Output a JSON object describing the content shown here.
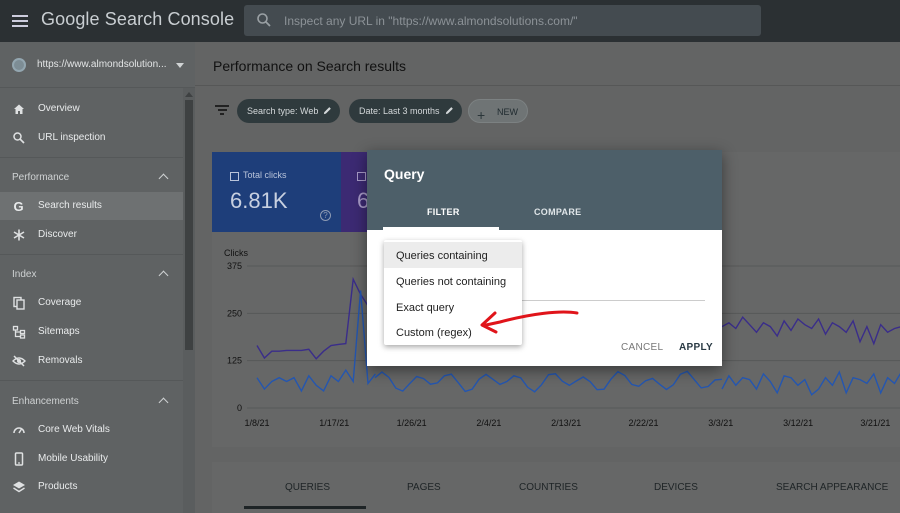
{
  "app": {
    "logo_text": "Google Search Console",
    "search_placeholder": "Inspect any URL in \"https://www.almondsolutions.com/\""
  },
  "sidebar": {
    "property": "https://www.almondsolution...",
    "items_top": [
      {
        "label": "Overview",
        "icon": "home-icon"
      },
      {
        "label": "URL inspection",
        "icon": "search-icon"
      }
    ],
    "sections": [
      {
        "title": "Performance",
        "items": [
          {
            "label": "Search results",
            "icon": "google-g-icon",
            "active": true
          },
          {
            "label": "Discover",
            "icon": "asterisk-icon"
          }
        ]
      },
      {
        "title": "Index",
        "items": [
          {
            "label": "Coverage",
            "icon": "pages-icon"
          },
          {
            "label": "Sitemaps",
            "icon": "sitemap-icon"
          },
          {
            "label": "Removals",
            "icon": "eye-off-icon"
          }
        ]
      },
      {
        "title": "Enhancements",
        "items": [
          {
            "label": "Core Web Vitals",
            "icon": "gauge-icon"
          },
          {
            "label": "Mobile Usability",
            "icon": "phone-icon"
          },
          {
            "label": "Products",
            "icon": "layers-icon"
          }
        ]
      }
    ]
  },
  "main": {
    "title": "Performance on Search results",
    "chips": [
      "Search type: Web",
      "Date: Last 3 months"
    ],
    "new_label": "NEW",
    "card_clicks": {
      "label": "Total clicks",
      "value": "6.81K",
      "help": "?"
    },
    "card_imps": {
      "value": "6"
    },
    "tabs": [
      "QUERIES",
      "PAGES",
      "COUNTRIES",
      "DEVICES",
      "SEARCH APPEARANCE"
    ]
  },
  "chart_data": {
    "type": "line",
    "ylabel": "Clicks",
    "y_ticks": [
      "375",
      "250",
      "125",
      "0"
    ],
    "x_ticks": [
      "1/8/21",
      "1/17/21",
      "1/26/21",
      "2/4/21",
      "2/13/21",
      "2/22/21",
      "3/3/21",
      "3/12/21",
      "3/21/21"
    ],
    "ylim": [
      0,
      375
    ],
    "series": [
      {
        "values": [
          165,
          132,
          150,
          150,
          152,
          152,
          152,
          155,
          130,
          150,
          165,
          168,
          170,
          340,
          300,
          270
        ],
        "right_values": [
          215,
          225,
          210,
          240,
          220,
          200,
          225,
          215,
          190,
          230,
          205,
          235,
          220,
          210,
          235,
          195,
          225,
          215,
          200,
          230,
          175,
          215,
          170,
          220,
          200,
          210,
          215
        ]
      },
      {
        "values": [
          80,
          50,
          70,
          80,
          70,
          80,
          45,
          85,
          60,
          45,
          85,
          70,
          100,
          70,
          310,
          65,
          90
        ],
        "right_values": [
          50,
          85,
          60,
          80,
          75,
          50,
          90,
          70,
          40,
          85,
          80,
          60,
          75,
          35,
          50,
          80,
          60,
          95,
          40,
          80,
          75,
          65,
          90,
          40,
          80,
          65,
          95
        ]
      }
    ],
    "colors": {
      "clicks": "#1e3e7a",
      "impressions": "#3c2a73"
    }
  },
  "dialog": {
    "title": "Query",
    "tab_filter": "FILTER",
    "tab_compare": "COMPARE",
    "cancel": "CANCEL",
    "apply": "APPLY",
    "options": [
      "Queries containing",
      "Queries not containing",
      "Exact query",
      "Custom (regex)"
    ]
  }
}
